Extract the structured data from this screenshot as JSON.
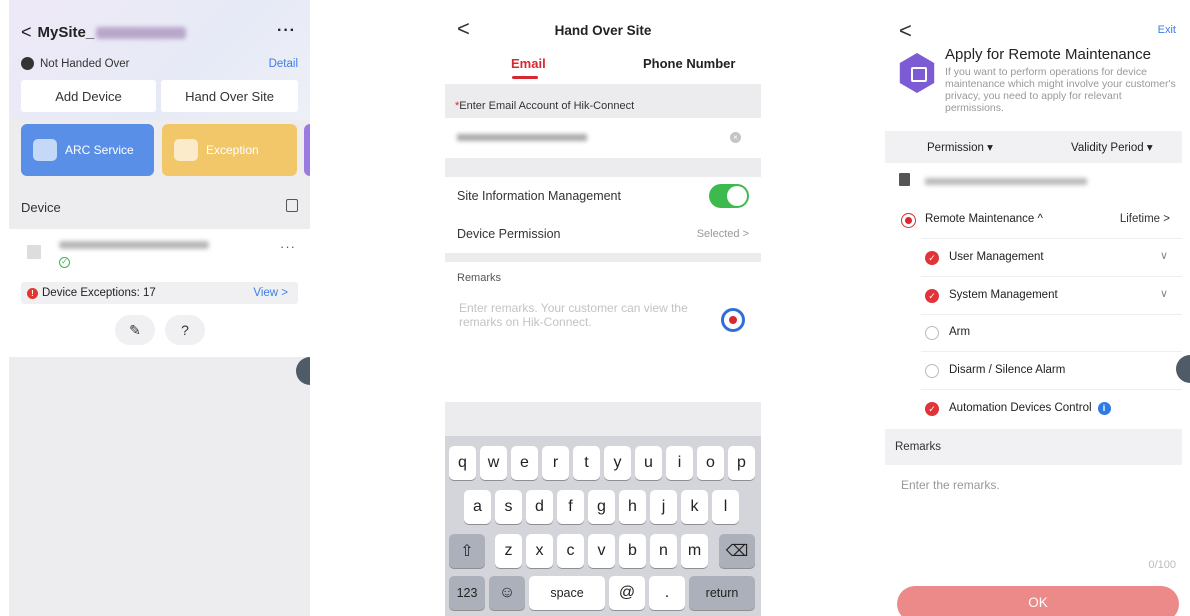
{
  "screen1": {
    "site_title": "MySite_",
    "more_label": "···",
    "status": "Not Handed Over",
    "detail_link": "Detail",
    "add_device": "Add Device",
    "hand_over": "Hand Over Site",
    "cards": [
      "ARC Service",
      "Exception"
    ],
    "device_section": "Device",
    "device_more": "···",
    "exceptions": "Device Exceptions: 17",
    "view_link": "View >",
    "edit_icon": "✎",
    "help_icon": "?"
  },
  "screen2": {
    "back": "<",
    "title": "Hand Over Site",
    "tabs": [
      "Email",
      "Phone Number"
    ],
    "email_label_req": "*",
    "email_label": "Enter Email Account of Hik-Connect",
    "site_info_mgmt": "Site Information Management",
    "device_permission": "Device Permission",
    "device_permission_value": "Selected >",
    "remarks_label": "Remarks",
    "remarks_placeholder": "Enter remarks. Your customer can view the remarks on Hik-Connect.",
    "keyboard": {
      "row1": [
        "q",
        "w",
        "e",
        "r",
        "t",
        "y",
        "u",
        "i",
        "o",
        "p"
      ],
      "row2": [
        "a",
        "s",
        "d",
        "f",
        "g",
        "h",
        "j",
        "k",
        "l"
      ],
      "row3": [
        "z",
        "x",
        "c",
        "v",
        "b",
        "n",
        "m"
      ],
      "shift": "⇧",
      "backspace": "⌫",
      "num": "123",
      "emoji": "☺",
      "space": "space",
      "at": "@",
      "dot": ".",
      "return": "return"
    }
  },
  "screen3": {
    "back": "<",
    "exit": "Exit",
    "title": "Apply for Remote Maintenance",
    "description": "If you want to perform operations for device maintenance which might involve your customer's privacy, you need to apply for relevant permissions.",
    "col_permission": "Permission ▾",
    "col_validity": "Validity Period ▾",
    "remote_maintenance": "Remote Maintenance ^",
    "lifetime": "Lifetime >",
    "permissions": [
      {
        "label": "User Management",
        "checked": true,
        "expandable": true
      },
      {
        "label": "System Management",
        "checked": true,
        "expandable": true
      },
      {
        "label": "Arm",
        "checked": false,
        "expandable": false
      },
      {
        "label": "Disarm / Silence Alarm",
        "checked": false,
        "expandable": false
      },
      {
        "label": "Automation Devices Control",
        "checked": true,
        "expandable": false
      }
    ],
    "remarks_label": "Remarks",
    "remarks_placeholder": "Enter the remarks.",
    "counter": "0/100",
    "ok": "OK"
  },
  "colors": {
    "accent_red": "#d8282f",
    "link_blue": "#3d7ee6",
    "toggle_green": "#3dba4e",
    "ok_button": "#ec8a8a",
    "card_blue": "#5a8fe8",
    "card_yellow": "#f2c769",
    "card_purple": "#9a7ce0"
  }
}
